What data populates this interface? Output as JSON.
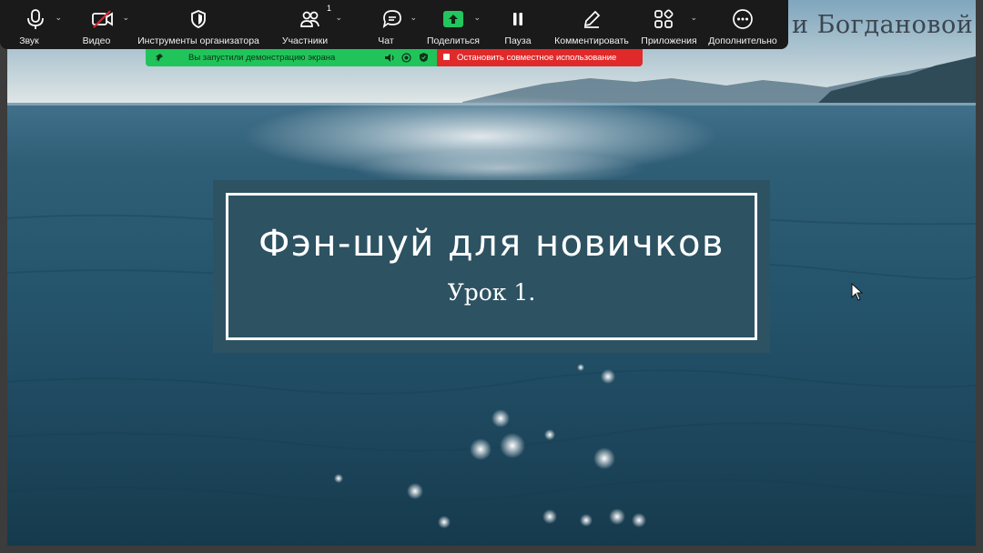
{
  "toolbar": {
    "items": [
      {
        "label": "Звук",
        "icon": "microphone-icon"
      },
      {
        "label": "Видео",
        "icon": "video-off-icon"
      },
      {
        "label": "Инструменты организатора",
        "icon": "shield-icon"
      },
      {
        "label": "Участники",
        "icon": "participants-icon",
        "badge": "1"
      },
      {
        "label": "Чат",
        "icon": "chat-icon"
      },
      {
        "label": "Поделиться",
        "icon": "share-screen-icon"
      },
      {
        "label": "Пауза",
        "icon": "pause-icon"
      },
      {
        "label": "Комментировать",
        "icon": "annotate-pencil-icon"
      },
      {
        "label": "Приложения",
        "icon": "apps-icon"
      },
      {
        "label": "Дополнительно",
        "icon": "more-icon"
      }
    ]
  },
  "share_bar": {
    "status_text": "Вы запустили демонстрацию экрана",
    "stop_text": "Остановить совместное использование",
    "green_color": "#21c45a",
    "red_color": "#e02a2a"
  },
  "slide": {
    "author_fragment": "и Богдановой",
    "title": "Фэн-шуй для новичков",
    "subtitle": "Урок 1."
  },
  "colors": {
    "toolbar_bg": "#1a1a1a",
    "share_accent": "#22c55e",
    "title_box": "#2d5262"
  }
}
